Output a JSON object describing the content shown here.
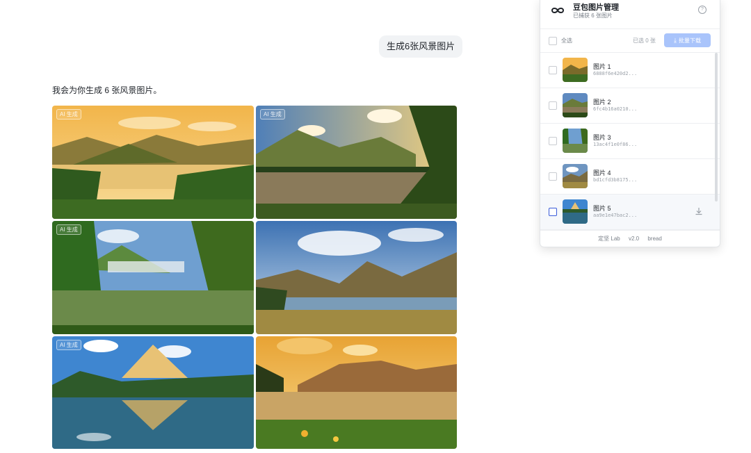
{
  "chat": {
    "user_message": "生成6张风景图片",
    "reply_text": "我会为你生成 6 张风景图片。",
    "ai_badge": "AI 生成"
  },
  "images": [
    {
      "scene": "golden-hour-lake-forest",
      "badge": true
    },
    {
      "scene": "lake-pine-sunrise-path",
      "badge": true
    },
    {
      "scene": "forest-lake-sunbeams",
      "badge": true
    },
    {
      "scene": "mountain-lake-meadow-clouds",
      "badge": false
    },
    {
      "scene": "alpine-peak-reflection",
      "badge": true
    },
    {
      "scene": "sunset-mountain-wildflowers",
      "badge": false
    }
  ],
  "panel": {
    "title": "豆包图片管理",
    "subtitle": "已捕获 6 张图片",
    "select_all": "全选",
    "selected_count": "已选 0 张",
    "batch_download": "批量下载",
    "items": [
      {
        "name": "图片 1",
        "hash": "6888f6e420d2..."
      },
      {
        "name": "图片 2",
        "hash": "6fc4b16a0210..."
      },
      {
        "name": "图片 3",
        "hash": "13ac4f1e0f86..."
      },
      {
        "name": "图片 4",
        "hash": "bd1cfd3b8175..."
      },
      {
        "name": "图片 5",
        "hash": "aa9e1e47bac2..."
      }
    ],
    "footer": {
      "brand": "定坚 Lab",
      "version": "v2.0",
      "author": "bread"
    }
  },
  "colors": {
    "accent": "#3a5bd9",
    "download_btn": "#a9c4fb",
    "bubble": "#f1f3f5"
  }
}
